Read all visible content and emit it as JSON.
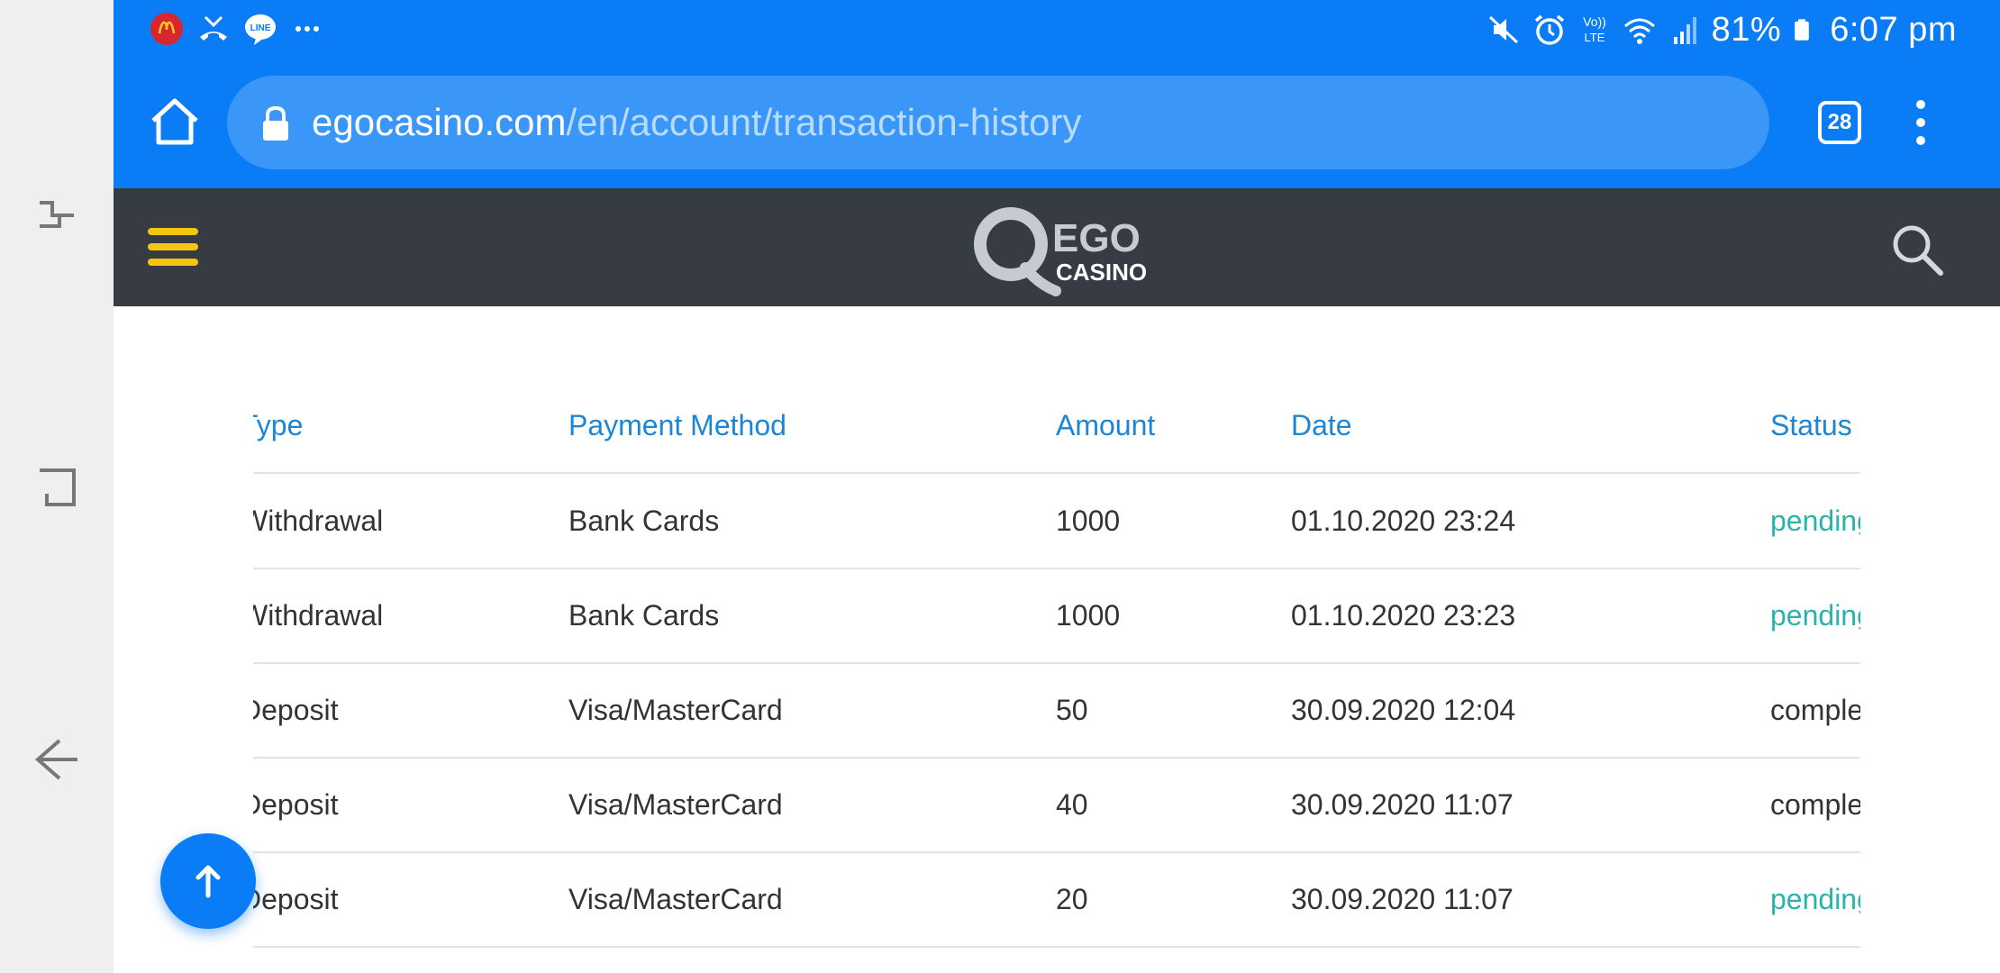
{
  "status_bar": {
    "notification_icons": [
      "mcdonalds-app-icon",
      "missed-call-icon",
      "line-app-icon",
      "more-dots-icon"
    ],
    "line_badge": "LINE",
    "network_label_top": "Vo))",
    "network_label_bottom": "LTE",
    "battery_percent": "81%",
    "time": "6:07 pm"
  },
  "browser": {
    "url_host": "egocasino.com",
    "url_path": "/en/account/transaction-history",
    "tab_count": "28"
  },
  "site": {
    "logo_word": "EGO",
    "logo_sub": "CASINO"
  },
  "table": {
    "headers": {
      "type": "Type",
      "payment_method": "Payment Method",
      "amount": "Amount",
      "date": "Date",
      "status": "Status"
    },
    "rows": [
      {
        "type": "Withdrawal",
        "payment_method": "Bank Cards",
        "amount": "1000",
        "date": "01.10.2020 23:24",
        "status": "pending"
      },
      {
        "type": "Withdrawal",
        "payment_method": "Bank Cards",
        "amount": "1000",
        "date": "01.10.2020 23:23",
        "status": "pending"
      },
      {
        "type": "Deposit",
        "payment_method": "Visa/MasterCard",
        "amount": "50",
        "date": "30.09.2020 12:04",
        "status": "completed"
      },
      {
        "type": "Deposit",
        "payment_method": "Visa/MasterCard",
        "amount": "40",
        "date": "30.09.2020 11:07",
        "status": "completed"
      },
      {
        "type": "Deposit",
        "payment_method": "Visa/MasterCard",
        "amount": "20",
        "date": "30.09.2020 11:07",
        "status": "pending"
      }
    ]
  },
  "colors": {
    "browser_blue": "#0a7cf5",
    "header_dark": "#363b44",
    "hamburger_yellow": "#f6c512",
    "link_blue": "#1b86d6",
    "pending_teal": "#2bb3a9"
  }
}
